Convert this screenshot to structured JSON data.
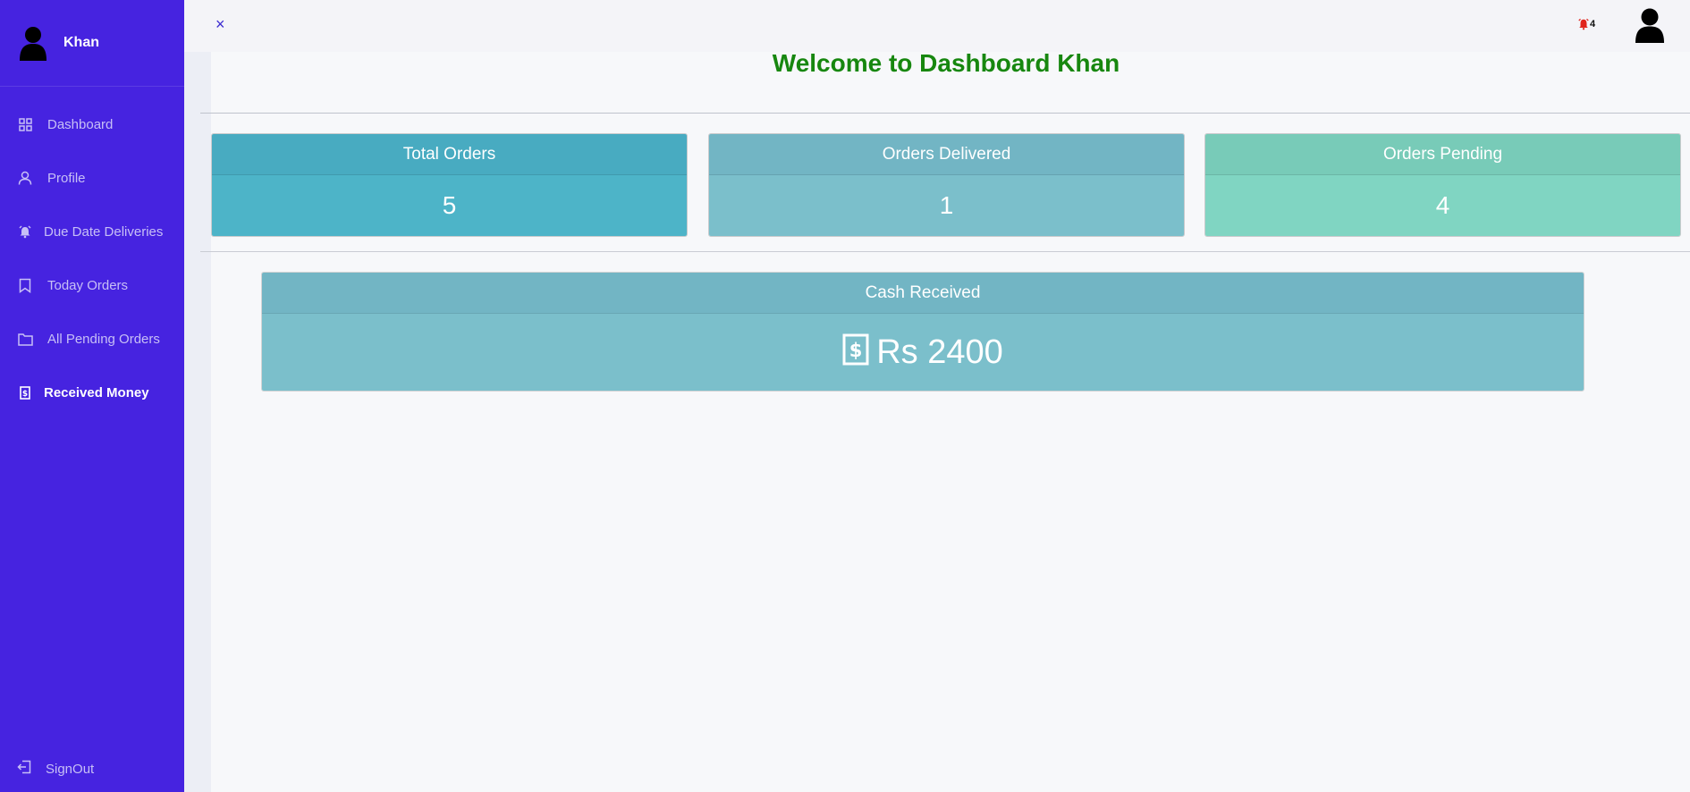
{
  "sidebar": {
    "username": "Khan",
    "items": [
      {
        "label": "Dashboard",
        "icon": "grid-icon"
      },
      {
        "label": "Profile",
        "icon": "user-icon"
      },
      {
        "label": "Due Date Deliveries",
        "icon": "alarm-icon"
      },
      {
        "label": "Today Orders",
        "icon": "bookmark-icon"
      },
      {
        "label": "All Pending Orders",
        "icon": "folder-icon"
      },
      {
        "label": "Received Money",
        "icon": "money-bill-icon",
        "active": true
      }
    ],
    "signout_label": "SignOut",
    "background_color": "#4623e0"
  },
  "topbar": {
    "close_symbol": "×",
    "notification_count": "4"
  },
  "main": {
    "welcome_text": "Welcome to Dashboard Khan",
    "welcome_color": "#17870f",
    "cards": [
      {
        "title": "Total Orders",
        "value": "5"
      },
      {
        "title": "Orders Delivered",
        "value": "1"
      },
      {
        "title": "Orders Pending",
        "value": "4"
      }
    ],
    "cash": {
      "title": "Cash Received",
      "value": "Rs 2400"
    }
  }
}
